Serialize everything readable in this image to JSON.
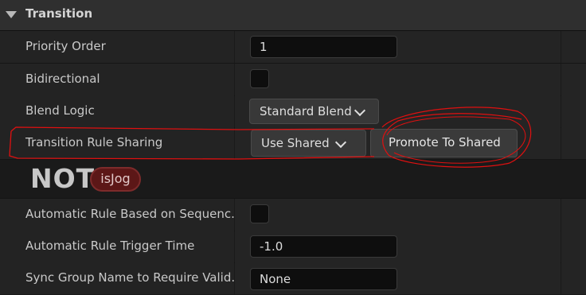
{
  "section": {
    "title": "Transition",
    "icon": "collapse-triangle-icon"
  },
  "rows": {
    "priority": {
      "label": "Priority Order",
      "value": "1"
    },
    "bidirectional": {
      "label": "Bidirectional"
    },
    "blend": {
      "label": "Blend Logic",
      "value": "Standard Blend"
    },
    "sharing": {
      "label": "Transition Rule Sharing",
      "value": "Use Shared",
      "button": "Promote To Shared"
    },
    "not_node": {
      "not": "NOT",
      "var": "isJog"
    },
    "auto_rule": {
      "label": "Automatic Rule Based on Sequenc..."
    },
    "trigger": {
      "label": "Automatic Rule Trigger Time",
      "value": "-1.0"
    },
    "sync": {
      "label": "Sync Group Name to Require Valid...",
      "value": "None"
    }
  },
  "colors": {
    "annotation": "#e01010",
    "pill": "#5c1717"
  }
}
